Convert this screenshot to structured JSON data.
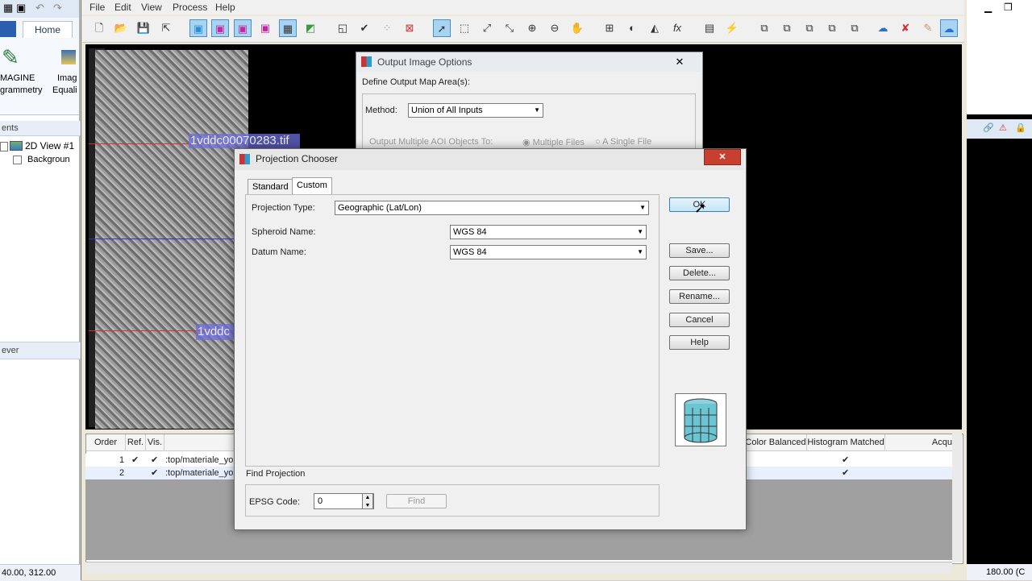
{
  "left_app": {
    "home_tab": "Home",
    "ribbon_imagine": "MAGINE",
    "ribbon_photogrammetry": "grammetry",
    "ribbon_image": "Imag",
    "ribbon_equalize": "Equali",
    "contents_header": "ents",
    "view_label": "2D View #1",
    "background_label": "Backgroun",
    "viewer_header": "ever",
    "status_coords": "40.00, 312.00"
  },
  "menu": {
    "file": "File",
    "edit": "Edit",
    "view": "View",
    "process": "Process",
    "help": "Help"
  },
  "canvas": {
    "tile_label_1": "1vddc00070283.tif",
    "tile_label_2": "1vddc"
  },
  "table": {
    "headers": {
      "order": "Order",
      "ref": "Ref.",
      "vis": "Vis.",
      "color_balanced": "Color Balanced",
      "histogram_matched": "Histogram Matched",
      "acq": "Acqu"
    },
    "rows": [
      {
        "order": "1",
        "ref": "✔",
        "vis": "✔",
        "path": ":top/materiale_you",
        "hist": "✔"
      },
      {
        "order": "2",
        "ref": "",
        "vis": "✔",
        "path": ":top/materiale_you",
        "hist": "✔"
      }
    ]
  },
  "right_app": {
    "status": "180.00 (C"
  },
  "output_dialog": {
    "title": "Output Image Options",
    "close": "✕",
    "define_label": "Define Output Map Area(s):",
    "method_label": "Method:",
    "method_value": "Union of All Inputs",
    "output_aoi_label": "Output Multiple AOI Objects To:",
    "multiple_files": "Multiple Files",
    "single_file": "A Single File"
  },
  "projection_dialog": {
    "title": "Projection Chooser",
    "close": "✕",
    "tabs": [
      "Standard",
      "Custom"
    ],
    "projection_type_label": "Projection Type:",
    "projection_type_value": "Geographic (Lat/Lon)",
    "spheroid_label": "Spheroid Name:",
    "spheroid_value": "WGS 84",
    "datum_label": "Datum Name:",
    "datum_value": "WGS 84",
    "buttons": {
      "ok": "OK",
      "save": "Save...",
      "delete": "Delete...",
      "rename": "Rename...",
      "cancel": "Cancel",
      "help": "Help"
    },
    "find_section": "Find Projection",
    "epsg_label": "EPSG Code:",
    "epsg_value": "0",
    "find_button": "Find"
  }
}
